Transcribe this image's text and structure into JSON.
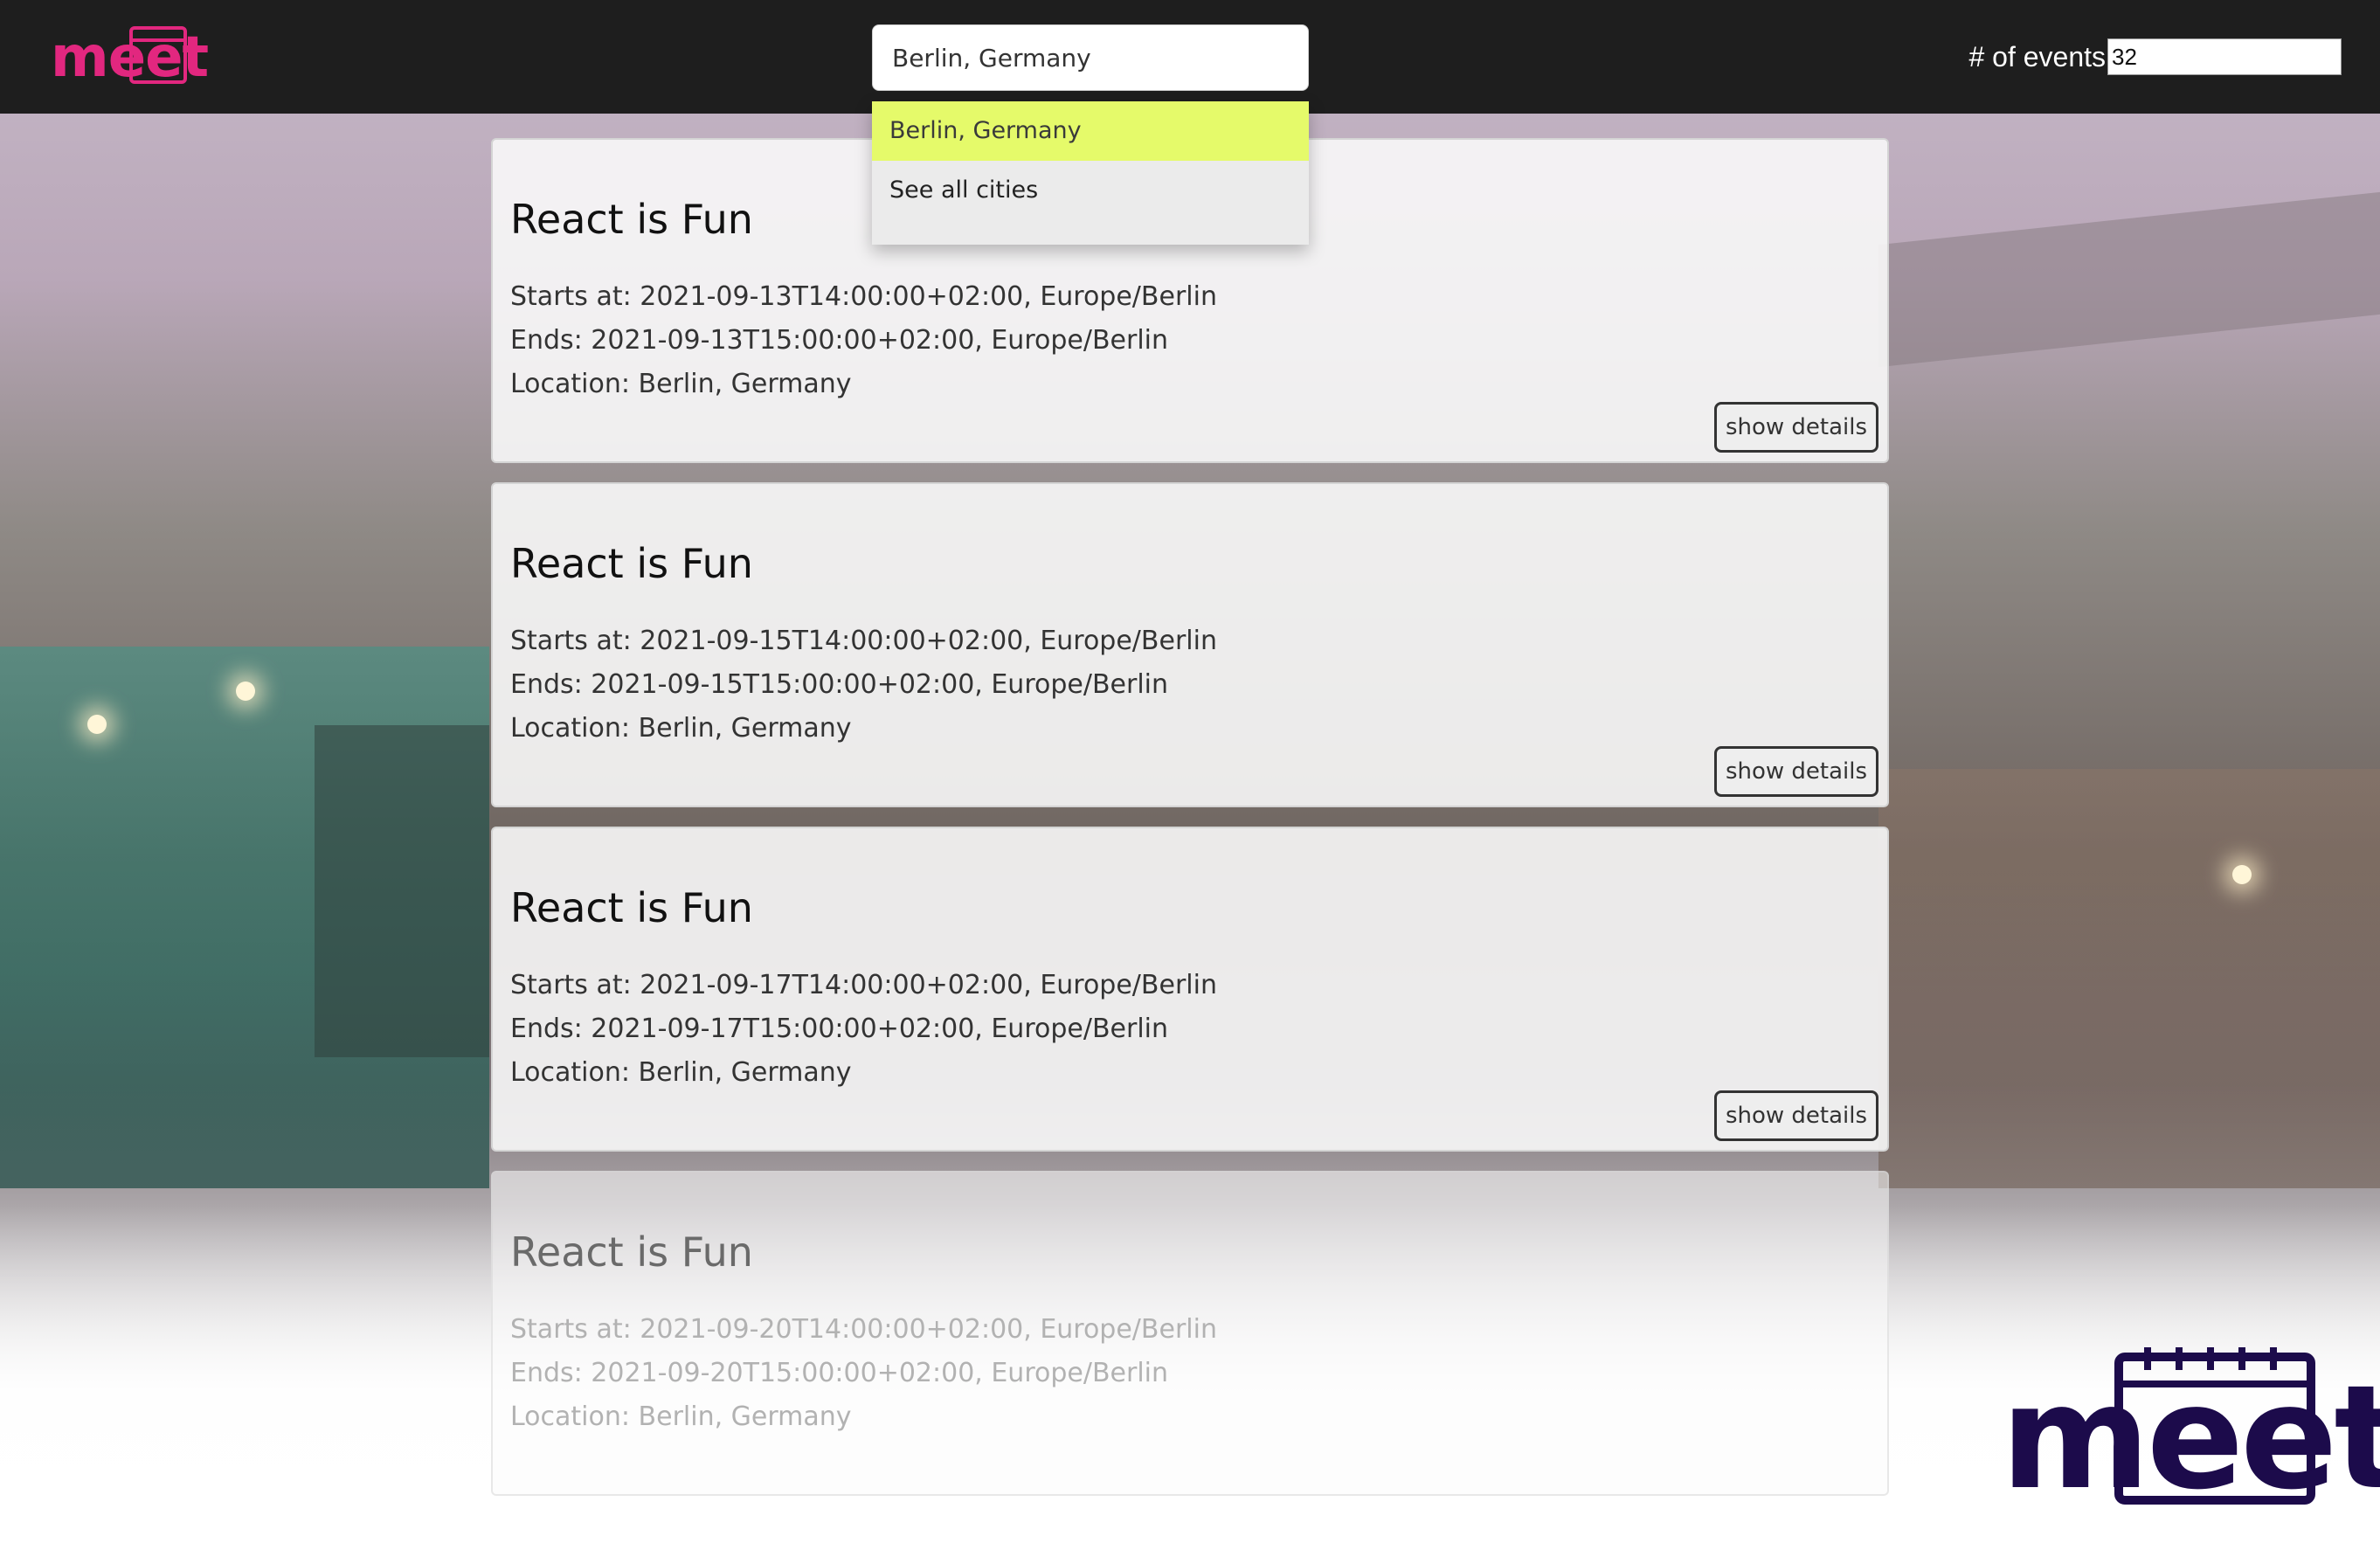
{
  "app": {
    "logo_text": "meet",
    "brand_color": "#e2277f",
    "logo_large_color": "#1c0b4b"
  },
  "header": {
    "search": {
      "value": "Berlin, Germany",
      "placeholder": ""
    },
    "suggestions": [
      {
        "label": "Berlin, Germany",
        "active": true
      },
      {
        "label": "See all cities",
        "active": false
      }
    ],
    "num_events": {
      "label": "# of events",
      "value": "32"
    }
  },
  "events": [
    {
      "title": "React is Fun",
      "start": "Starts at: 2021-09-13T14:00:00+02:00, Europe/Berlin",
      "end": "Ends: 2021-09-13T15:00:00+02:00, Europe/Berlin",
      "location": "Location: Berlin, Germany",
      "button": "show details"
    },
    {
      "title": "React is Fun",
      "start": "Starts at: 2021-09-15T14:00:00+02:00, Europe/Berlin",
      "end": "Ends: 2021-09-15T15:00:00+02:00, Europe/Berlin",
      "location": "Location: Berlin, Germany",
      "button": "show details"
    },
    {
      "title": "React is Fun",
      "start": "Starts at: 2021-09-17T14:00:00+02:00, Europe/Berlin",
      "end": "Ends: 2021-09-17T15:00:00+02:00, Europe/Berlin",
      "location": "Location: Berlin, Germany",
      "button": "show details"
    },
    {
      "title": "React is Fun",
      "start": "Starts at: 2021-09-20T14:00:00+02:00, Europe/Berlin",
      "end": "Ends: 2021-09-20T15:00:00+02:00, Europe/Berlin",
      "location": "Location: Berlin, Germany"
    }
  ],
  "colors": {
    "header_bg": "#1e1e1e",
    "suggestion_active": "#e5fa6a",
    "card_bg": "#f8f8f8"
  }
}
